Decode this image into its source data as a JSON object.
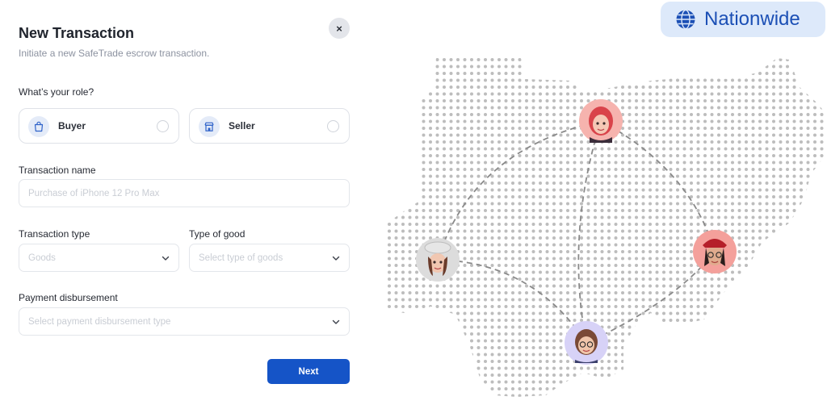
{
  "dialog": {
    "title": "New Transaction",
    "subtitle": "Initiate a new SafeTrade escrow transaction.",
    "close_label": "×"
  },
  "role": {
    "label": "What’s your role?",
    "options": [
      {
        "label": "Buyer",
        "icon": "shopping-bag-icon",
        "selected": false
      },
      {
        "label": "Seller",
        "icon": "store-icon",
        "selected": false
      }
    ]
  },
  "transaction_name": {
    "label": "Transaction name",
    "placeholder": "Purchase of iPhone 12 Pro Max",
    "value": ""
  },
  "transaction_type": {
    "label": "Transaction type",
    "placeholder": "Goods"
  },
  "type_of_good": {
    "label": "Type of good",
    "placeholder": "Select type of goods"
  },
  "payment_disbursement": {
    "label": "Payment disbursement",
    "placeholder": "Select payment disbursement type"
  },
  "actions": {
    "next_label": "Next"
  },
  "badge": {
    "label": "Nationwide",
    "icon": "globe-icon"
  },
  "colors": {
    "primary": "#1554c7",
    "badge_bg": "#dde9fa",
    "badge_text": "#1b4fb5",
    "map_dots": "#bdbdbd"
  }
}
